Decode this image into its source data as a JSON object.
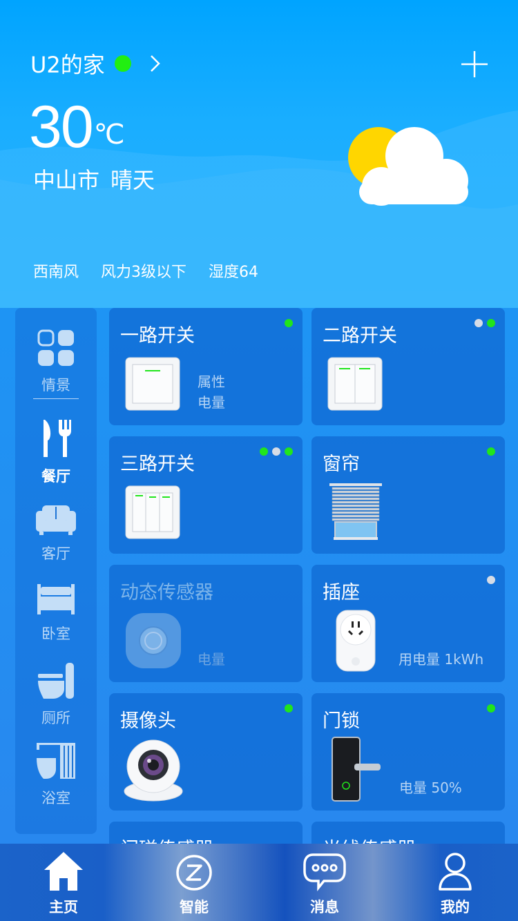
{
  "header": {
    "home_name": "U2的家",
    "online_color": "#22ee11",
    "temperature": "30",
    "temp_unit": "℃",
    "city": "中山市",
    "weather": "晴天",
    "wind_direction": "西南风",
    "wind_level": "风力3级以下",
    "humidity": "湿度64",
    "add_icon": "plus-icon",
    "weather_icon": "partly-sunny-icon"
  },
  "sidebar": {
    "items": [
      {
        "label": "情景",
        "icon": "scene-grid-icon"
      },
      {
        "label": "餐厅",
        "icon": "dining-icon"
      },
      {
        "label": "客厅",
        "icon": "sofa-icon"
      },
      {
        "label": "卧室",
        "icon": "bed-icon"
      },
      {
        "label": "厕所",
        "icon": "toilet-icon"
      },
      {
        "label": "浴室",
        "icon": "bathtub-icon"
      }
    ],
    "active": "餐厅"
  },
  "devices": [
    {
      "title": "一路开关",
      "info1": "属性",
      "info2": "电量",
      "status": [
        "online"
      ]
    },
    {
      "title": "二路开关",
      "status": [
        "off",
        "online"
      ]
    },
    {
      "title": "三路开关",
      "status": [
        "online",
        "off",
        "online"
      ]
    },
    {
      "title": "窗帘",
      "status": [
        "online"
      ]
    },
    {
      "title": "动态传感器",
      "info1": "电量",
      "status": []
    },
    {
      "title": "插座",
      "info1": "用电量  1kWh",
      "status": [
        "off"
      ]
    },
    {
      "title": "摄像头",
      "status": [
        "online"
      ]
    },
    {
      "title": "门锁",
      "info1": "电量  50%",
      "status": [
        "online"
      ]
    },
    {
      "title": "门磁传感器"
    },
    {
      "title": "光线传感器"
    }
  ],
  "bottom_nav": [
    {
      "label": "主页",
      "icon": "home-icon"
    },
    {
      "label": "智能",
      "icon": "smart-icon"
    },
    {
      "label": "消息",
      "icon": "message-icon"
    },
    {
      "label": "我的",
      "icon": "user-icon"
    }
  ],
  "colors": {
    "status_online": "#21e51c",
    "status_off": "#d6dce6",
    "header_blue": "#00a4ff",
    "card_blue": "#116cd6"
  }
}
